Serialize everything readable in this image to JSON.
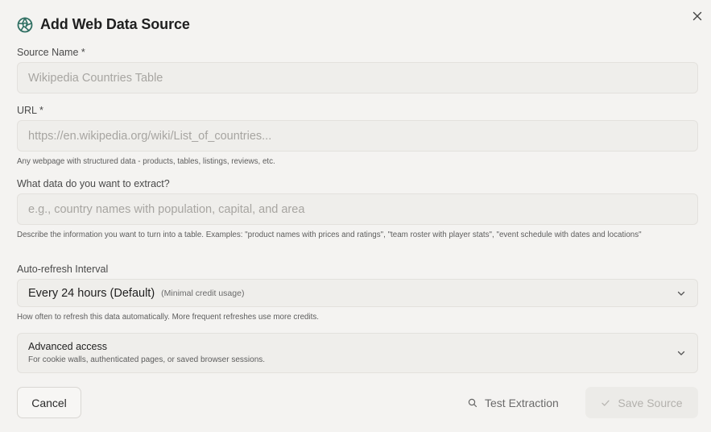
{
  "dialog": {
    "title": "Add Web Data Source",
    "logo_icon": "aperture-logo-icon",
    "close_icon": "close-icon"
  },
  "source_name": {
    "label": "Source Name *",
    "placeholder": "Wikipedia Countries Table",
    "value": ""
  },
  "url": {
    "label": "URL *",
    "placeholder": "https://en.wikipedia.org/wiki/List_of_countries...",
    "value": "",
    "hint": "Any webpage with structured data - products, tables, listings, reviews, etc."
  },
  "extract": {
    "label": "What data do you want to extract?",
    "placeholder": "e.g., country names with population, capital, and area",
    "value": "",
    "hint": "Describe the information you want to turn into a table. Examples: \"product names with prices and ratings\", \"team roster with player stats\", \"event schedule with dates and locations\""
  },
  "refresh": {
    "label": "Auto-refresh Interval",
    "selected": "Every 24 hours (Default)",
    "selected_note": "(Minimal credit usage)",
    "hint": "How often to refresh this data automatically. More frequent refreshes use more credits."
  },
  "advanced": {
    "title": "Advanced access",
    "subtitle": "For cookie walls, authenticated pages, or saved browser sessions."
  },
  "buttons": {
    "cancel": "Cancel",
    "test": "Test Extraction",
    "save": "Save Source"
  },
  "colors": {
    "accent": "#2f6f62",
    "background": "#f4f3f1",
    "field_bg": "#efeeeb"
  }
}
